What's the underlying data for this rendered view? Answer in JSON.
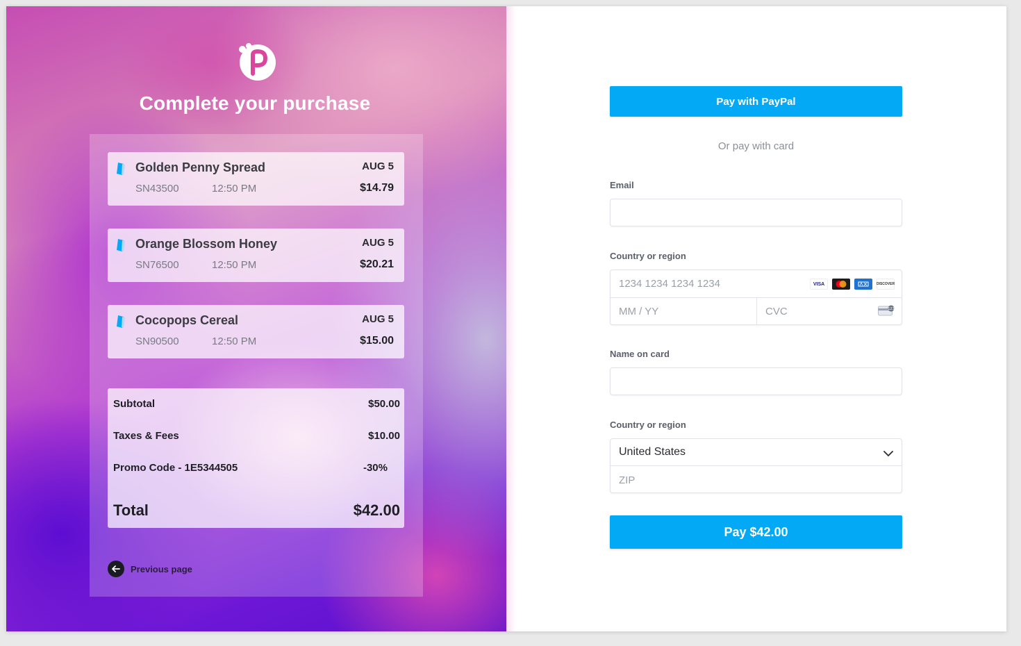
{
  "header": {
    "title": "Complete your purchase",
    "logo_icon": "p-logo-icon"
  },
  "order": {
    "items": [
      {
        "name": "Golden Penny Spread",
        "sku": "SN43500",
        "time": "12:50 PM",
        "date": "AUG 5",
        "price": "$14.79",
        "icon": "ticket-icon"
      },
      {
        "name": "Orange Blossom Honey",
        "sku": "SN76500",
        "time": "12:50 PM",
        "date": "AUG 5",
        "price": "$20.21",
        "icon": "ticket-icon"
      },
      {
        "name": "Cocopops Cereal",
        "sku": "SN90500",
        "time": "12:50 PM",
        "date": "AUG 5",
        "price": "$15.00",
        "icon": "ticket-icon"
      }
    ],
    "summary": {
      "subtotal_label": "Subtotal",
      "subtotal_value": "$50.00",
      "taxes_label": "Taxes & Fees",
      "taxes_value": "$10.00",
      "promo_label": "Promo Code - 1E5344505",
      "promo_value": "-30%",
      "total_label": "Total",
      "total_value": "$42.00"
    },
    "previous_label": "Previous page"
  },
  "payment": {
    "paypal_label": "Pay with PayPal",
    "or_text": "Or pay with card",
    "email_label": "Email",
    "email_value": "",
    "card_label": "Country or region",
    "card_number_placeholder": "1234 1234 1234 1234",
    "expiry_placeholder": "MM / YY",
    "cvc_placeholder": "CVC",
    "card_brands": [
      "VISA",
      "mastercard",
      "amex",
      "DISCOVER"
    ],
    "name_label": "Name on card",
    "name_value": "",
    "country_label": "Country or region",
    "country_value": "United States",
    "zip_placeholder": "ZIP",
    "pay_label": "Pay $42.00"
  },
  "colors": {
    "accent": "#03a9f4",
    "text_dark": "#1e1e24"
  }
}
